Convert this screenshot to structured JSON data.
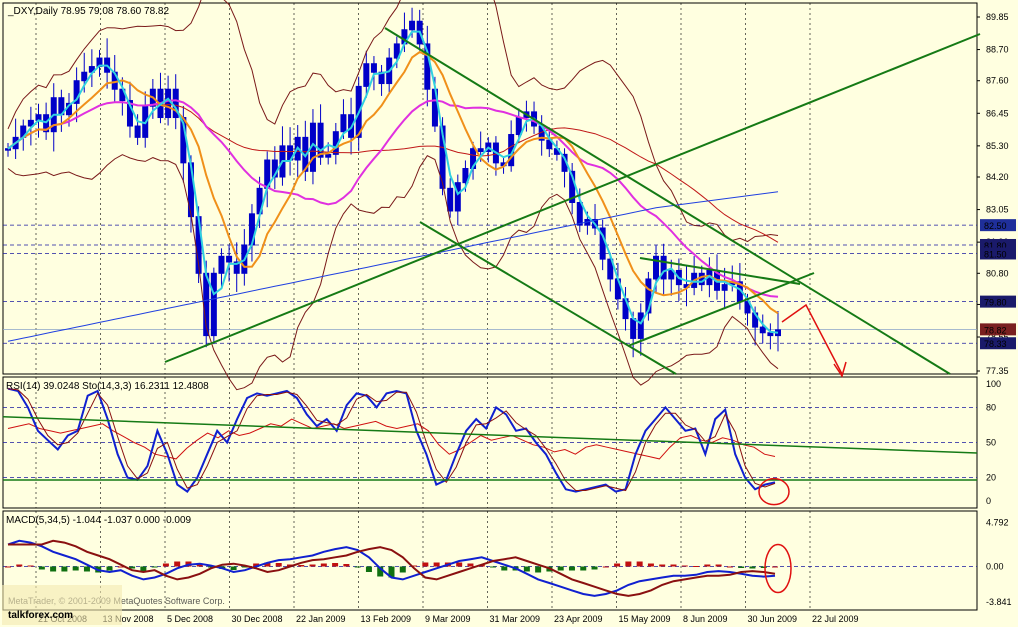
{
  "title": "_DXY,Daily",
  "ohlc": "78.95 79.08 78.60 78.82",
  "chart_data": [
    {
      "type": "candlestick",
      "symbol": "_DXY",
      "timeframe": "Daily",
      "x_labels": [
        "21 Oct 2008",
        "13 Nov 2008",
        "5 Dec 2008",
        "30 Dec 2008",
        "22 Jan 2009",
        "13 Feb 2009",
        "9 Mar 2009",
        "31 Mar 2009",
        "23 Apr 2009",
        "15 May 2009",
        "8 Jun 2009",
        "30 Jun 2009",
        "22 Jul 2009"
      ],
      "y_ticks": [
        "89.85",
        "88.70",
        "87.60",
        "86.45",
        "85.30",
        "84.20",
        "83.05",
        "81.90",
        "80.80",
        "79.70",
        "78.55",
        "77.35"
      ],
      "ylim": [
        77.35,
        89.85
      ],
      "price_levels": [
        {
          "label": "82.50",
          "value": 82.5,
          "highlight": true
        },
        {
          "label": "81.80",
          "value": 81.8
        },
        {
          "label": "81.50",
          "value": 81.5
        },
        {
          "label": "79.80",
          "value": 79.8
        },
        {
          "label": "78.82",
          "value": 78.82,
          "current": true
        },
        {
          "label": "78.33",
          "value": 78.33
        }
      ],
      "close_series": [
        85.2,
        85.6,
        86.0,
        86.2,
        86.4,
        85.8,
        87.0,
        86.4,
        86.8,
        87.6,
        87.9,
        88.1,
        88.4,
        87.9,
        87.3,
        86.9,
        86.0,
        85.6,
        86.7,
        87.3,
        86.3,
        87.3,
        86.3,
        84.7,
        82.8,
        80.8,
        78.6,
        80.8,
        81.4,
        81.2,
        80.8,
        81.8,
        82.9,
        83.8,
        84.8,
        84.2,
        85.3,
        84.8,
        85.6,
        84.4,
        86.1,
        84.9,
        85.0,
        85.8,
        86.4,
        85.6,
        87.4,
        88.2,
        87.9,
        87.5,
        88.4,
        88.9,
        89.4,
        89.7,
        88.9,
        87.3,
        86.0,
        83.8,
        83.0,
        84.0,
        84.5,
        85.2,
        85.1,
        85.4,
        84.7,
        84.6,
        85.7,
        86.3,
        86.5,
        86.0,
        85.5,
        85.2,
        85.0,
        84.4,
        83.3,
        82.5,
        82.7,
        82.4,
        81.3,
        80.6,
        79.9,
        79.2,
        78.5,
        79.4,
        80.6,
        81.4,
        80.6,
        80.9,
        80.4,
        80.3,
        80.8,
        80.4,
        80.9,
        80.2,
        80.4,
        80.5,
        79.8,
        79.4,
        78.9,
        78.7,
        78.6,
        78.8
      ],
      "indicators": [
        "Bollinger Bands",
        "Moving Average (fast)",
        "Moving Average (slow)",
        "Moving Average (long-term)"
      ]
    },
    {
      "type": "line",
      "title": "RSI(14) 39.0248  Sto(14,3,3) 16.2311 12.4808",
      "y_ticks": [
        "100",
        "80",
        "50",
        "20",
        "0"
      ],
      "ylim": [
        0,
        100
      ],
      "levels": [
        80,
        50,
        20
      ],
      "series": [
        {
          "name": "RSI(14)",
          "last": 39.0248,
          "values": [
            62,
            64,
            66,
            62,
            60,
            58,
            60,
            62,
            64,
            66,
            60,
            55,
            50,
            46,
            40,
            38,
            36,
            45,
            52,
            58,
            54,
            60,
            56,
            58,
            62,
            66,
            64,
            70,
            66,
            62,
            64,
            66,
            62,
            64,
            66,
            68,
            64,
            62,
            64,
            66,
            60,
            48,
            40,
            44,
            50,
            56,
            52,
            54,
            56,
            52,
            48,
            46,
            42,
            44,
            40,
            46,
            48,
            46,
            44,
            42,
            40,
            38,
            36,
            46,
            54,
            56,
            52,
            50,
            54,
            52,
            48,
            46,
            40,
            38
          ]
        },
        {
          "name": "Sto(14,3,3)",
          "last": 16.2311,
          "signal": 12.4808,
          "values": [
            96,
            94,
            80,
            60,
            52,
            44,
            56,
            60,
            90,
            94,
            70,
            40,
            20,
            18,
            30,
            60,
            40,
            14,
            8,
            20,
            40,
            60,
            50,
            70,
            88,
            92,
            90,
            92,
            94,
            88,
            74,
            64,
            70,
            60,
            82,
            92,
            90,
            80,
            92,
            94,
            92,
            60,
            40,
            14,
            18,
            40,
            60,
            70,
            62,
            80,
            74,
            60,
            62,
            50,
            40,
            24,
            10,
            8,
            10,
            12,
            14,
            8,
            10,
            40,
            60,
            70,
            80,
            70,
            60,
            62,
            40,
            70,
            78,
            40,
            20,
            10,
            14,
            16
          ]
        }
      ],
      "annotation": "circle"
    },
    {
      "type": "bar+line",
      "title": "MACD(5,34,5) -1.044 -1.037 0.000 -0.009",
      "y_ticks": [
        "4.792",
        "0.00",
        "-3.841"
      ],
      "ylim": [
        -3.841,
        4.792
      ],
      "values": {
        "macd": -1.044,
        "signal": -1.037,
        "histogram_a": 0.0,
        "histogram_b": -0.009
      },
      "macd_series": [
        2.4,
        2.8,
        2.6,
        2.2,
        1.6,
        1.2,
        0.8,
        0.2,
        -0.4,
        -0.6,
        -0.4,
        -1.0,
        -1.4,
        -1.2,
        -0.8,
        -0.2,
        0.2,
        0.3,
        0.1,
        -0.2,
        -0.6,
        -0.4,
        0.0,
        0.4,
        0.7,
        0.8,
        1.0,
        1.2,
        1.6,
        1.9,
        2.1,
        1.8,
        1.0,
        -0.2,
        -1.2,
        -1.4,
        -1.0,
        -0.6,
        -0.2,
        0.2,
        0.6,
        0.8,
        1.0,
        0.6,
        0.2,
        -0.2,
        -0.8,
        -1.4,
        -1.8,
        -2.2,
        -2.6,
        -3.0,
        -3.2,
        -3.0,
        -2.6,
        -2.0,
        -1.6,
        -1.4,
        -1.2,
        -1.0,
        -1.0,
        -0.9,
        -0.6,
        -0.5,
        -0.6,
        -0.8,
        -1.0,
        -1.1,
        -1.0
      ],
      "annotation": "circle"
    }
  ],
  "watermark": {
    "left": "MetaTrader, © 2001-2009 MetaQuotes Software Corp.",
    "brand": "talkforex.com"
  }
}
